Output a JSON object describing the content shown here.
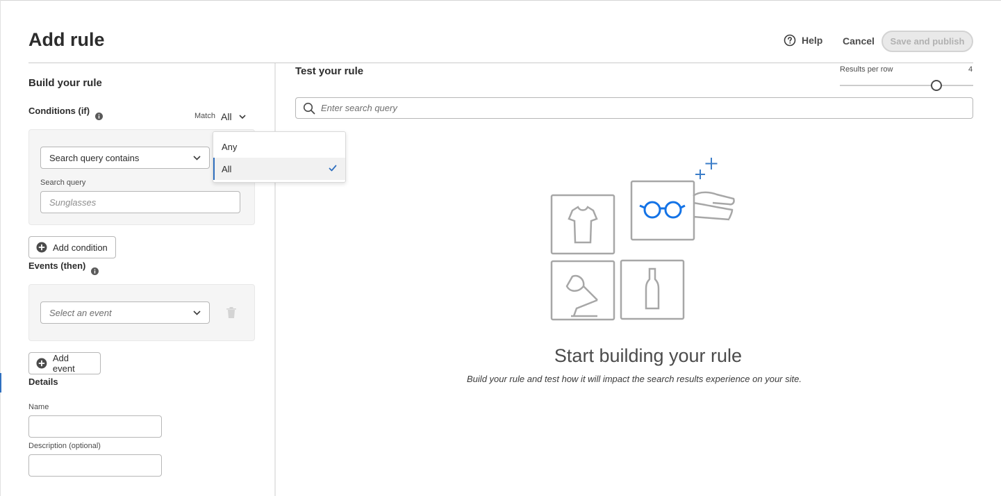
{
  "header": {
    "title": "Add rule",
    "help_label": "Help",
    "cancel_label": "Cancel",
    "save_label": "Save and publish"
  },
  "build": {
    "title": "Build your rule",
    "conditions_label": "Conditions (if)",
    "match_label": "Match",
    "match_value": "All",
    "condition_picker_value": "Search query contains",
    "search_query_label": "Search query",
    "search_query_placeholder": "Sunglasses",
    "add_condition_label": "Add condition",
    "events_label": "Events (then)",
    "event_picker_placeholder": "Select an event",
    "add_event_label": "Add event"
  },
  "match_menu": {
    "options": [
      "Any",
      "All"
    ],
    "selected": "All"
  },
  "details": {
    "title": "Details",
    "name_label": "Name",
    "description_label": "Description (optional)"
  },
  "test": {
    "title": "Test your rule",
    "results_per_row_label": "Results per row",
    "results_per_row_value": "4",
    "search_placeholder": "Enter search query",
    "empty_title": "Start building your rule",
    "empty_subtitle": "Build your rule and test how it will impact the search results experience on your site."
  },
  "colors": {
    "accent": "#2f6fbf",
    "glasses": "#1473e6",
    "illustration_stroke": "#a7a7a7"
  }
}
